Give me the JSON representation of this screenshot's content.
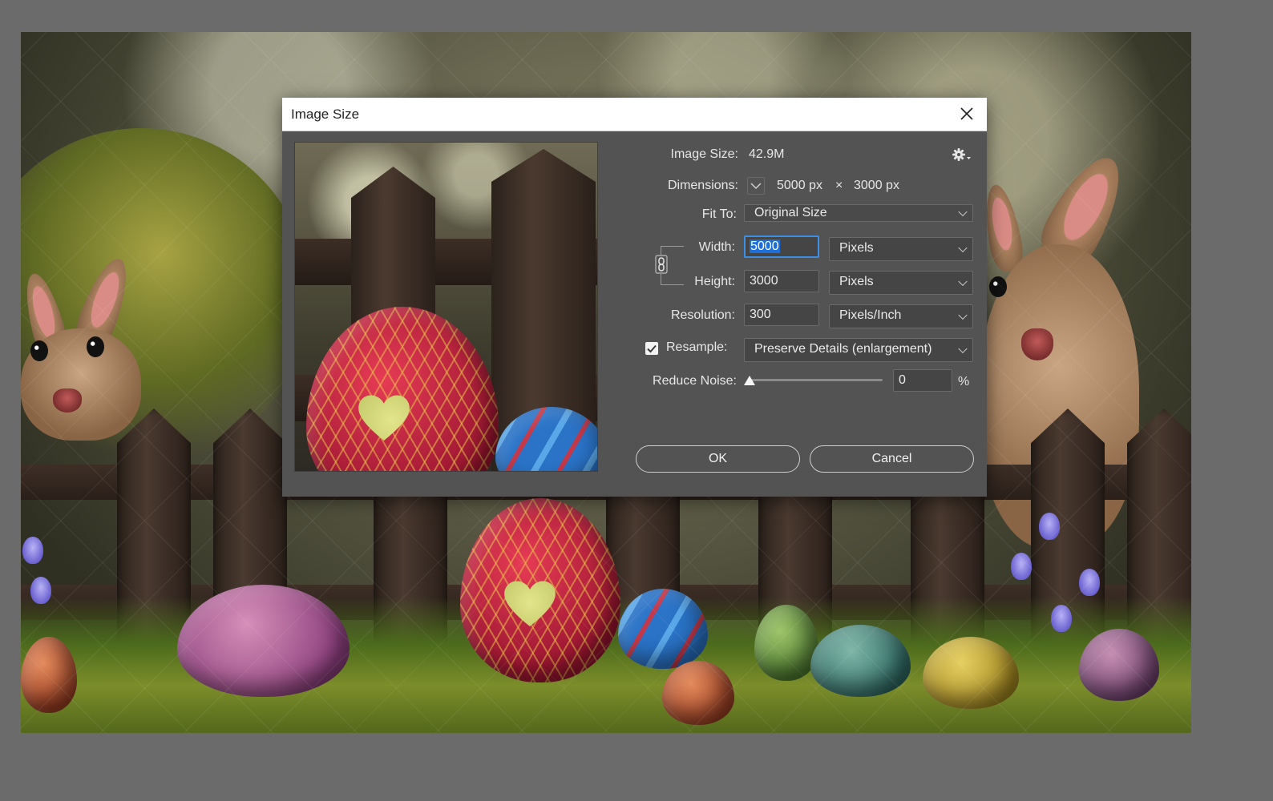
{
  "dialog": {
    "title": "Image Size",
    "close_icon": "close-x-icon",
    "image_size_label": "Image Size:",
    "image_size_value": "42.9M",
    "settings_icon": "gear-icon",
    "dimensions_label": "Dimensions:",
    "dimensions_width": "5000 px",
    "dimensions_times": "×",
    "dimensions_height": "3000 px",
    "fit_to_label": "Fit To:",
    "fit_to_value": "Original Size",
    "width_label": "Width:",
    "width_value": "5000",
    "width_unit": "Pixels",
    "height_label": "Height:",
    "height_value": "3000",
    "height_unit": "Pixels",
    "link_icon": "chain-link-icon",
    "resolution_label": "Resolution:",
    "resolution_value": "300",
    "resolution_unit": "Pixels/Inch",
    "resample_label": "Resample:",
    "resample_checked": true,
    "resample_value": "Preserve Details (enlargement)",
    "reduce_noise_label": "Reduce Noise:",
    "reduce_noise_value": "0",
    "reduce_noise_percent": 0,
    "reduce_noise_unit": "%",
    "ok_label": "OK",
    "cancel_label": "Cancel"
  },
  "colors": {
    "dialog_bg": "#535353",
    "workspace_bg": "#6b6b6b",
    "focus_blue": "#3d8fe6"
  }
}
